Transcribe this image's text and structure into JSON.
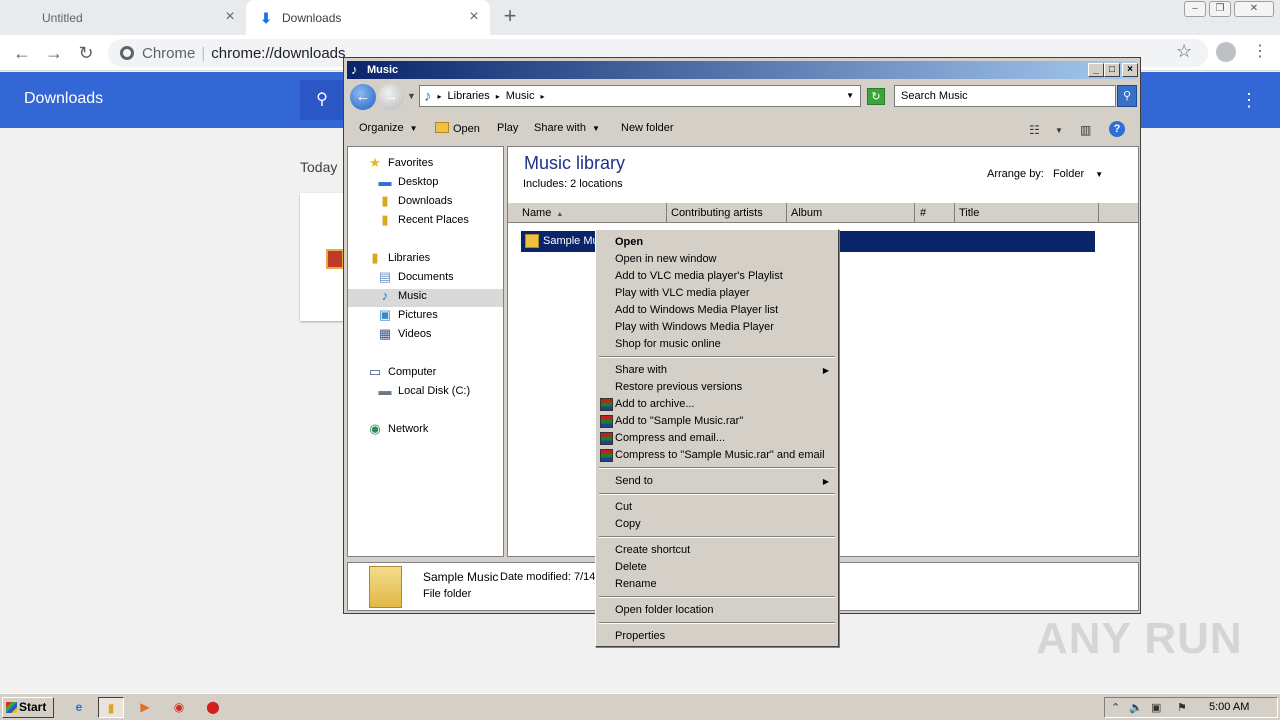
{
  "chrome": {
    "tabs": [
      {
        "label": "Untitled"
      },
      {
        "label": "Downloads"
      }
    ],
    "omnibox": {
      "site": "Chrome",
      "url": "chrome://downloads"
    }
  },
  "downloads_page": {
    "title": "Downloads",
    "section": "Today"
  },
  "explorer": {
    "title": "Music",
    "breadcrumbs": [
      "Libraries",
      "Music"
    ],
    "search_placeholder": "Search Music",
    "commands": {
      "organize": "Organize",
      "open": "Open",
      "play": "Play",
      "share_with": "Share with",
      "new_folder": "New folder"
    },
    "nav": {
      "favorites": "Favorites",
      "desktop": "Desktop",
      "downloads": "Downloads",
      "recent_places": "Recent Places",
      "libraries": "Libraries",
      "documents": "Documents",
      "music": "Music",
      "pictures": "Pictures",
      "videos": "Videos",
      "computer": "Computer",
      "local_disk": "Local Disk (C:)",
      "network": "Network"
    },
    "library": {
      "title": "Music library",
      "includes_label": "Includes:",
      "includes_value": "2 locations",
      "arrange_label": "Arrange by:",
      "arrange_value": "Folder"
    },
    "columns": [
      "Name",
      "Contributing artists",
      "Album",
      "#",
      "Title"
    ],
    "files": [
      {
        "name": "Sample Mus"
      }
    ],
    "details": {
      "name": "Sample Music",
      "modified": "Date modified: 7/14",
      "type": "File folder"
    }
  },
  "context_menu": {
    "open": "Open",
    "open_new_window": "Open in new window",
    "add_vlc_playlist": "Add to VLC media player's Playlist",
    "play_vlc": "Play with VLC media player",
    "add_wmp_list": "Add to Windows Media Player list",
    "play_wmp": "Play with Windows Media Player",
    "shop_music": "Shop for music online",
    "share_with": "Share with",
    "restore_versions": "Restore previous versions",
    "add_archive": "Add to archive...",
    "add_rar": "Add to \"Sample Music.rar\"",
    "compress_email": "Compress and email...",
    "compress_rar_email": "Compress to \"Sample Music.rar\" and email",
    "send_to": "Send to",
    "cut": "Cut",
    "copy": "Copy",
    "create_shortcut": "Create shortcut",
    "delete": "Delete",
    "rename": "Rename",
    "open_folder_location": "Open folder location",
    "properties": "Properties"
  },
  "watermark": "ANY RUN",
  "taskbar": {
    "start": "Start",
    "clock": "5:00 AM"
  }
}
